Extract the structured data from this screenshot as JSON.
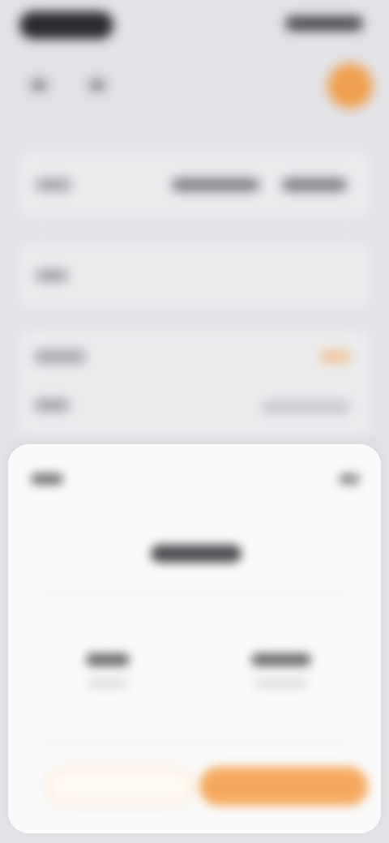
{
  "colors": {
    "accent": "#f5a95e",
    "avatar": "#f0a050",
    "background": "#e3e3e7",
    "sheet": "#fafafa"
  },
  "status_bar": {
    "left_icon": "time-pill",
    "right_icon": "status-indicators"
  },
  "nav": {
    "back_icon": "back-icon",
    "menu_icon": "menu-icon",
    "avatar_icon": "avatar"
  },
  "sheet": {
    "close_icon": "close-icon"
  }
}
